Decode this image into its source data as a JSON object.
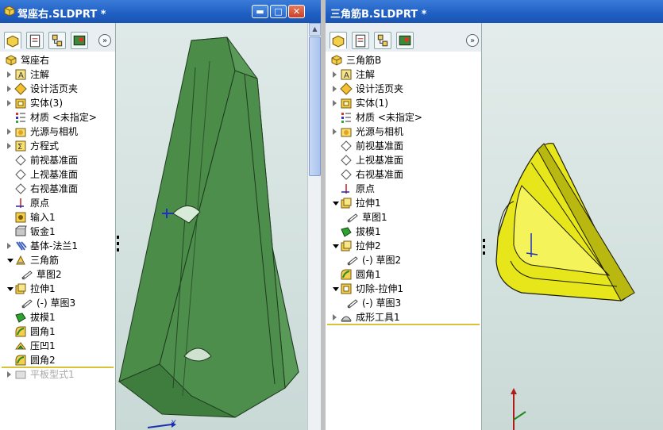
{
  "left_window": {
    "title": "驾座右.SLDPRT *",
    "tree": [
      {
        "label": "驾座右",
        "icon": "part-icon",
        "expander": "none",
        "indent": 0
      },
      {
        "label": "注解",
        "icon": "annotations-icon",
        "expander": "collapsed",
        "indent": 1
      },
      {
        "label": "设计活页夹",
        "icon": "design-binder-icon",
        "expander": "collapsed",
        "indent": 1
      },
      {
        "label": "实体(3)",
        "icon": "solid-bodies-icon",
        "expander": "collapsed",
        "indent": 1
      },
      {
        "label": "材质 <未指定>",
        "icon": "material-icon",
        "expander": "none",
        "indent": 1
      },
      {
        "label": "光源与相机",
        "icon": "lights-cameras-icon",
        "expander": "collapsed",
        "indent": 1
      },
      {
        "label": "方程式",
        "icon": "equations-icon",
        "expander": "collapsed",
        "indent": 1
      },
      {
        "label": "前视基准面",
        "icon": "plane-icon",
        "expander": "none",
        "indent": 1
      },
      {
        "label": "上视基准面",
        "icon": "plane-icon",
        "expander": "none",
        "indent": 1
      },
      {
        "label": "右视基准面",
        "icon": "plane-icon",
        "expander": "none",
        "indent": 1
      },
      {
        "label": "原点",
        "icon": "origin-icon",
        "expander": "none",
        "indent": 1
      },
      {
        "label": "输入1",
        "icon": "imported-body-icon",
        "expander": "none",
        "indent": 1
      },
      {
        "label": "钣金1",
        "icon": "sheet-metal-icon",
        "expander": "none",
        "indent": 1
      },
      {
        "label": "基体-法兰1",
        "icon": "base-flange-icon",
        "expander": "collapsed",
        "indent": 1
      },
      {
        "label": "三角筋",
        "icon": "rib-icon",
        "expander": "expanded",
        "indent": 1
      },
      {
        "label": "草图2",
        "icon": "sketch-icon",
        "expander": "none",
        "indent": 2
      },
      {
        "label": "拉伸1",
        "icon": "extrude-icon",
        "expander": "expanded",
        "indent": 1
      },
      {
        "label": "(-) 草图3",
        "icon": "sketch-icon",
        "expander": "none",
        "indent": 2
      },
      {
        "label": "拔模1",
        "icon": "draft-icon",
        "expander": "none",
        "indent": 1
      },
      {
        "label": "圆角1",
        "icon": "fillet-icon",
        "expander": "none",
        "indent": 1
      },
      {
        "label": "压凹1",
        "icon": "indent-feature-icon",
        "expander": "none",
        "indent": 1
      },
      {
        "label": "圆角2",
        "icon": "fillet-icon",
        "expander": "none",
        "indent": 1
      },
      {
        "label": "平板型式1",
        "icon": "flat-pattern-icon",
        "expander": "collapsed",
        "indent": 1,
        "suppressed": true
      }
    ],
    "triad_labels": {
      "y": "Y"
    }
  },
  "right_window": {
    "title": "三角筋B.SLDPRT *",
    "tree": [
      {
        "label": "三角筋B",
        "icon": "part-icon",
        "expander": "none",
        "indent": 0
      },
      {
        "label": "注解",
        "icon": "annotations-icon",
        "expander": "collapsed",
        "indent": 1
      },
      {
        "label": "设计活页夹",
        "icon": "design-binder-icon",
        "expander": "collapsed",
        "indent": 1
      },
      {
        "label": "实体(1)",
        "icon": "solid-bodies-icon",
        "expander": "collapsed",
        "indent": 1
      },
      {
        "label": "材质 <未指定>",
        "icon": "material-icon",
        "expander": "none",
        "indent": 1
      },
      {
        "label": "光源与相机",
        "icon": "lights-cameras-icon",
        "expander": "collapsed",
        "indent": 1
      },
      {
        "label": "前视基准面",
        "icon": "plane-icon",
        "expander": "none",
        "indent": 1
      },
      {
        "label": "上视基准面",
        "icon": "plane-icon",
        "expander": "none",
        "indent": 1
      },
      {
        "label": "右视基准面",
        "icon": "plane-icon",
        "expander": "none",
        "indent": 1
      },
      {
        "label": "原点",
        "icon": "origin-icon",
        "expander": "none",
        "indent": 1
      },
      {
        "label": "拉伸1",
        "icon": "extrude-icon",
        "expander": "expanded",
        "indent": 1
      },
      {
        "label": "草图1",
        "icon": "sketch-icon",
        "expander": "none",
        "indent": 2
      },
      {
        "label": "拔模1",
        "icon": "draft-icon",
        "expander": "none",
        "indent": 1
      },
      {
        "label": "拉伸2",
        "icon": "extrude-icon",
        "expander": "expanded",
        "indent": 1
      },
      {
        "label": "(-) 草图2",
        "icon": "sketch-icon",
        "expander": "none",
        "indent": 2
      },
      {
        "label": "圆角1",
        "icon": "fillet-icon",
        "expander": "none",
        "indent": 1
      },
      {
        "label": "切除-拉伸1",
        "icon": "cut-extrude-icon",
        "expander": "expanded",
        "indent": 1
      },
      {
        "label": "(-) 草图3",
        "icon": "sketch-icon",
        "expander": "none",
        "indent": 2
      },
      {
        "label": "成形工具1",
        "icon": "forming-tool-icon",
        "expander": "collapsed",
        "indent": 1
      }
    ]
  },
  "tabs": [
    {
      "name": "feature-manager-tab",
      "icon": "feature-tree-icon"
    },
    {
      "name": "property-manager-tab",
      "icon": "property-icon"
    },
    {
      "name": "configuration-manager-tab",
      "icon": "configuration-icon"
    },
    {
      "name": "display-manager-tab",
      "icon": "display-icon"
    }
  ],
  "more_label": "»",
  "colors": {
    "title_bar": "#1f5fc4",
    "part_green": "#3e7a3e",
    "part_yellow": "#e8e820",
    "highlight": "#d8c23a"
  }
}
